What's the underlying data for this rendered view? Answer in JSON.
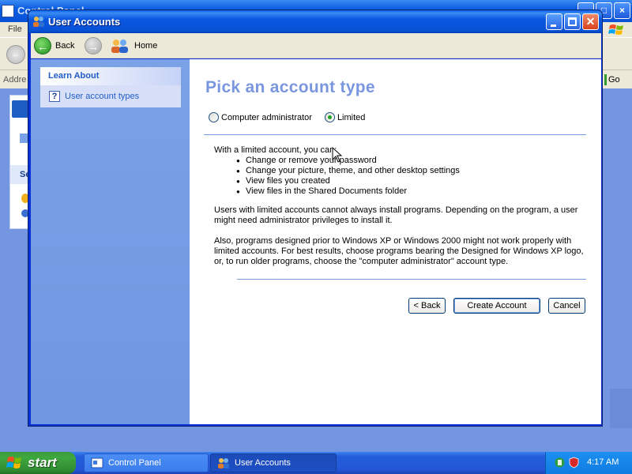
{
  "background_window": {
    "title": "Control Panel",
    "menu_file": "File",
    "address_label": "Addre",
    "go_label": "Go",
    "side_section_label": "Se"
  },
  "window": {
    "title": "User Accounts"
  },
  "toolbar": {
    "back_label": "Back",
    "home_label": "Home"
  },
  "sidebar": {
    "header": "Learn About",
    "items": [
      {
        "label": "User account types",
        "icon": "help-icon"
      }
    ]
  },
  "main": {
    "heading": "Pick an account type",
    "account_types": [
      {
        "label": "Computer administrator",
        "checked": false
      },
      {
        "label": "Limited",
        "checked": true
      }
    ],
    "intro": "With a limited account, you can:",
    "bullets": [
      "Change or remove your password",
      "Change your picture, theme, and other desktop settings",
      "View files you created",
      "View files in the Shared Documents folder"
    ],
    "para1": "Users with limited accounts cannot always install programs. Depending on the program, a user might need administrator privileges to install it.",
    "para2": "Also, programs designed prior to Windows XP or Windows 2000 might not work properly with limited accounts. For best results, choose programs bearing the Designed for Windows XP logo, or, to run older programs, choose the \"computer administrator\" account type.",
    "buttons": {
      "back": "< Back",
      "create": "Create Account",
      "cancel": "Cancel"
    }
  },
  "taskbar": {
    "start_label": "start",
    "tasks": [
      {
        "label": "Control Panel",
        "active": false
      },
      {
        "label": "User Accounts",
        "active": true
      }
    ],
    "clock": "4:17 AM"
  },
  "colors": {
    "accent_blue": "#0831d9",
    "heading_blue": "#7a96df",
    "link_blue": "#215dc6",
    "start_green": "#3fa83f"
  }
}
